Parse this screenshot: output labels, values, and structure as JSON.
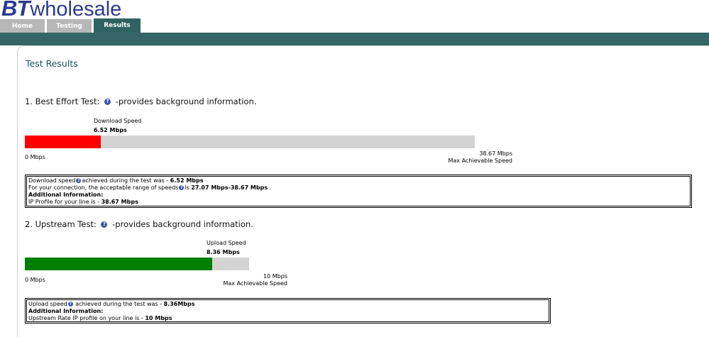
{
  "brand": {
    "logo_bt": "BT",
    "logo_word": "wholesale"
  },
  "nav": {
    "tabs": [
      {
        "label": "Home",
        "active": false
      },
      {
        "label": "Testing",
        "active": false
      },
      {
        "label": "Results",
        "active": true
      }
    ]
  },
  "page": {
    "title": "Test Results"
  },
  "help_icon": "question-circle-icon",
  "colors": {
    "download_bar": "#ff0000",
    "upload_bar": "#008000",
    "track": "#d3d3d3",
    "band": "#356566"
  },
  "best_effort": {
    "title": "1. Best Effort Test:",
    "desc": "-provides background information.",
    "speed_label": "Download Speed",
    "speed_value": "6.52 Mbps",
    "measured": 6.52,
    "max": 38.67,
    "min_label": "0 Mbps",
    "max_label": "38.67 Mbps",
    "max_caption": "Max Achievable Speed",
    "info": {
      "line1_pre": "Download speed",
      "line1_mid": "achieved during the test was - ",
      "line1_val": "6.52 Mbps",
      "line2_pre": "For your connection, the acceptable range of speeds",
      "line2_mid": "is ",
      "line2_val": "27.07 Mbps-38.67 Mbps",
      "line2_end": " .",
      "heading": "Additional Information:",
      "line3_pre": "IP Profile for your line is - ",
      "line3_val": "38.67 Mbps"
    }
  },
  "upstream": {
    "title": "2. Upstream Test:",
    "desc": "-provides background information.",
    "speed_label": "Upload Speed",
    "speed_value": "8.36 Mbps",
    "measured": 8.36,
    "max": 10,
    "min_label": "0 Mbps",
    "max_label": "10 Mbps",
    "max_caption": "Max Achievable Speed",
    "info": {
      "line1_pre": "Upload speed",
      "line1_mid": " achieved during the test was - ",
      "line1_val": "8.36Mbps",
      "heading": "Additional Information:",
      "line2_pre": "Upstream Rate IP profile on your line is - ",
      "line2_val": "10 Mbps"
    }
  }
}
